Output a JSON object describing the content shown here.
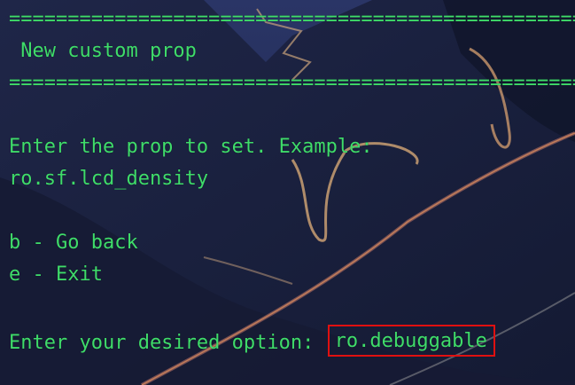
{
  "terminal": {
    "separator_top": "=================================================",
    "title": " New custom prop",
    "separator_bottom": "=================================================",
    "prompt_line": "Enter the prop to set. Example:",
    "example_value": "ro.sf.lcd_density",
    "options": [
      {
        "key": "b",
        "label": "b - Go back"
      },
      {
        "key": "e",
        "label": "e - Exit"
      }
    ],
    "input_prompt": "Enter your desired option: ",
    "input_value": "ro.debuggable"
  },
  "colors": {
    "text": "#3fdc6a",
    "highlight_box": "#e01010",
    "background": "#1a1f3a"
  }
}
